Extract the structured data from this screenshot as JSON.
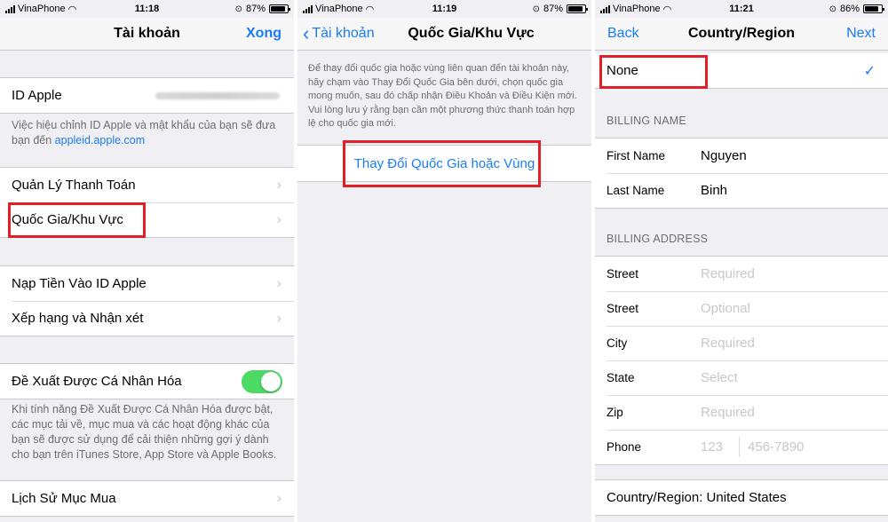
{
  "colors": {
    "accent": "#1a7cf5",
    "highlight": "#e21e26",
    "toggle_on": "#4cd964"
  },
  "panel1": {
    "status": {
      "carrier": "VinaPhone",
      "time": "11:18",
      "battery": "87%",
      "battery_level": 0.87
    },
    "nav": {
      "title": "Tài khoản",
      "right": "Xong"
    },
    "apple_id_label": "ID Apple",
    "apple_id_note": "Việc hiệu chỉnh ID Apple và mật khẩu của bạn sẽ đưa bạn đến ",
    "apple_id_link": "appleid.apple.com",
    "items_a": [
      "Quản Lý Thanh Toán",
      "Quốc Gia/Khu Vực"
    ],
    "items_b": [
      "Nạp Tiền Vào ID Apple",
      "Xếp hạng và Nhận xét"
    ],
    "personalized_label": "Đề Xuất Được Cá Nhân Hóa",
    "personalized_on": true,
    "personalized_note": "Khi tính năng Đề Xuất Được Cá Nhân Hóa được bật, các mục tải về, mục mua và các hoạt động khác của bạn sẽ được sử dụng để cải thiện những gợi ý dành cho bạn trên iTunes Store, App Store và Apple Books.",
    "purchase_history": "Lịch Sử Mục Mua"
  },
  "panel2": {
    "status": {
      "carrier": "VinaPhone",
      "time": "11:19",
      "battery": "87%",
      "battery_level": 0.87
    },
    "nav": {
      "back": "Tài khoản",
      "title": "Quốc Gia/Khu Vực"
    },
    "instructions": "Để thay đổi quốc gia hoặc vùng liên quan đến tài khoản này, hãy chạm vào Thay Đổi Quốc Gia bên dưới, chọn quốc gia mong muốn, sau đó chấp nhận Điều Khoản và Điều Kiện mới. Vui lòng lưu ý rằng bạn cần một phương thức thanh toán hợp lệ cho quốc gia mới.",
    "change_button": "Thay Đổi Quốc Gia hoặc Vùng"
  },
  "panel3": {
    "status": {
      "carrier": "VinaPhone",
      "time": "11:21",
      "battery": "86%",
      "battery_level": 0.86
    },
    "nav": {
      "back": "Back",
      "title": "Country/Region",
      "right": "Next"
    },
    "payment_none": "None",
    "billing_name_header": "BILLING NAME",
    "first_name_label": "First Name",
    "first_name_value": "Nguyen",
    "last_name_label": "Last Name",
    "last_name_value": "Binh",
    "billing_address_header": "BILLING ADDRESS",
    "address_fields": [
      {
        "label": "Street",
        "placeholder": "Required"
      },
      {
        "label": "Street",
        "placeholder": "Optional"
      },
      {
        "label": "City",
        "placeholder": "Required"
      },
      {
        "label": "State",
        "placeholder": "Select"
      },
      {
        "label": "Zip",
        "placeholder": "Required"
      }
    ],
    "phone_label": "Phone",
    "phone_area_placeholder": "123",
    "phone_number_placeholder": "456-7890",
    "country_region": "Country/Region: United States"
  }
}
